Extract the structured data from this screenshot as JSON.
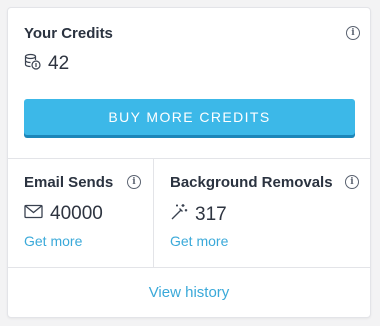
{
  "credits": {
    "title": "Your Credits",
    "value": "42",
    "buy_label": "BUY MORE CREDITS"
  },
  "stats": [
    {
      "title": "Email Sends",
      "value": "40000",
      "link": "Get more",
      "icon": "envelope-icon"
    },
    {
      "title": "Background Removals",
      "value": "317",
      "link": "Get more",
      "icon": "magic-wand-icon"
    }
  ],
  "footer": {
    "history_label": "View history"
  },
  "colors": {
    "accent": "#3cb8e8",
    "link": "#3aa9d9",
    "accent_shadow": "#1c86b9"
  }
}
